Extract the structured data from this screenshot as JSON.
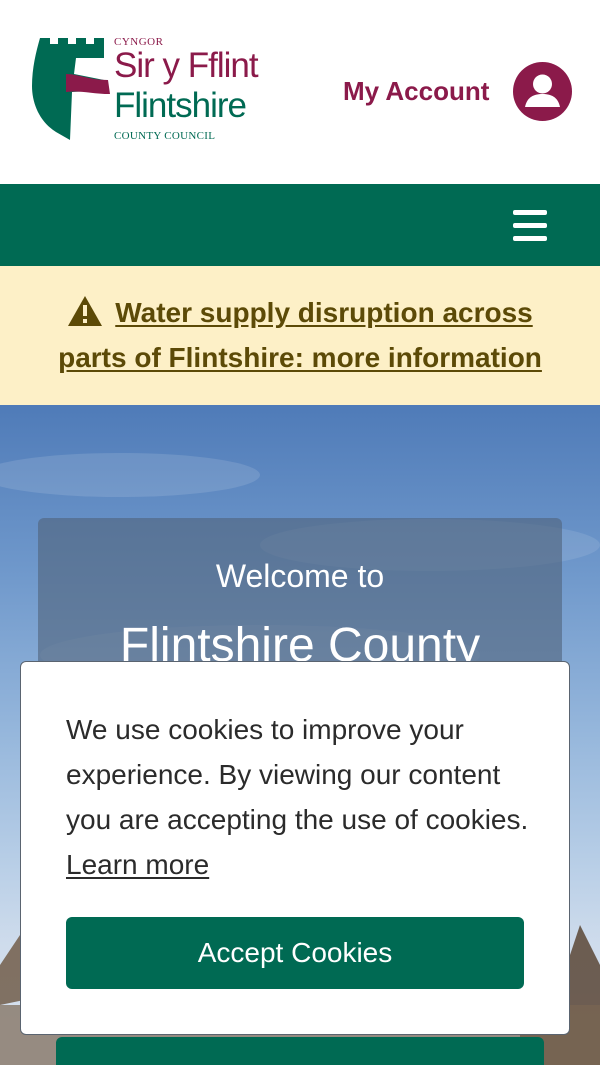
{
  "header": {
    "logo": {
      "small_welsh": "CYNGOR",
      "welsh_name": "Sir y Fflint",
      "english_name": "Flintshire",
      "subtitle": "COUNTY COUNCIL",
      "icon": "castle-tower-logo-icon"
    },
    "account": {
      "label": "My Account",
      "icon": "user-avatar-icon"
    }
  },
  "nav": {
    "menu_icon": "hamburger-menu-icon"
  },
  "alert": {
    "icon": "warning-triangle-icon",
    "link_text": "Water supply disruption across parts of Flintshire: more information"
  },
  "hero": {
    "welcome_small": "Welcome to",
    "welcome_big": "Flintshire County"
  },
  "cookie_banner": {
    "message": "We use cookies to improve your experience. By viewing our content you are accepting the use of cookies.",
    "learn_more": "Learn more",
    "accept_label": "Accept Cookies"
  },
  "colors": {
    "brand_green": "#006a53",
    "brand_maroon": "#8b1a4a",
    "alert_background": "#fdf0c7",
    "alert_text": "#5c4a07"
  }
}
